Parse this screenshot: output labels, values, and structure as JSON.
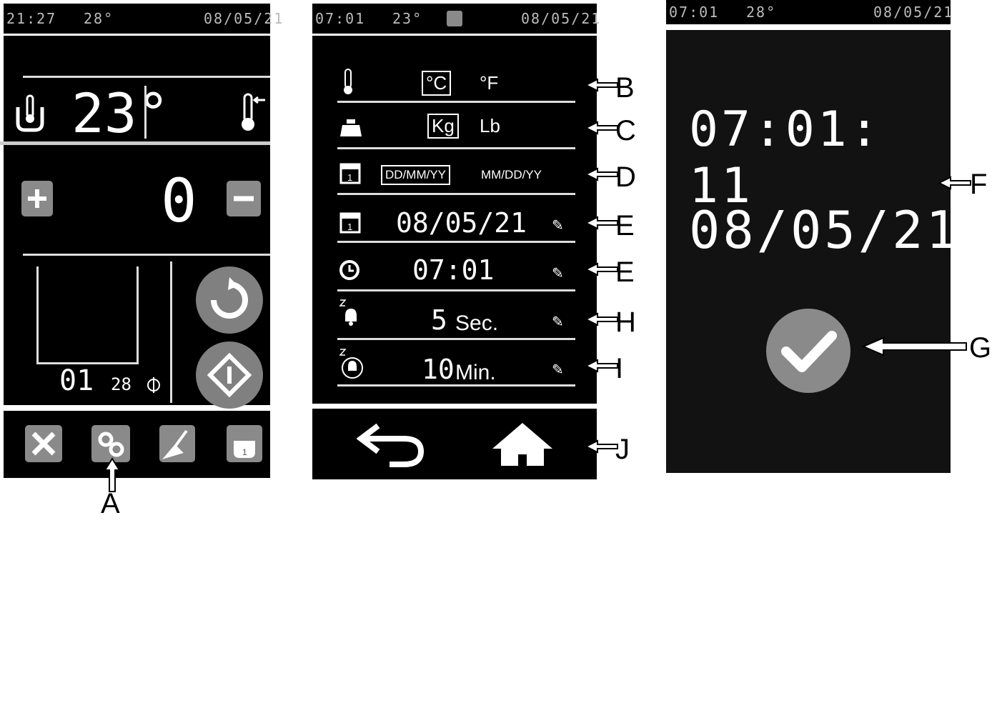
{
  "panel1": {
    "status": {
      "time": "21:27",
      "temp": "28°",
      "date": "08/05/21"
    },
    "temperature": "23°",
    "counter": "0",
    "program": "01",
    "small_value": "28"
  },
  "panel2": {
    "status": {
      "time": "07:01",
      "temp": "23°",
      "date": "08/05/21"
    },
    "temp_unit_options": [
      "°C",
      "°F"
    ],
    "weight_unit_options": [
      "Kg",
      "Lb"
    ],
    "date_format_options": [
      "DD/MM/YY",
      "MM/DD/YY"
    ],
    "date": "08/05/21",
    "time": "07:01",
    "alarm_duration": "5",
    "alarm_duration_unit": "Sec.",
    "repeat_interval": "10",
    "repeat_interval_unit": "Min."
  },
  "panel3": {
    "status": {
      "time": "07:01",
      "temp": "28°",
      "date": "08/05/21"
    },
    "clock_time": "07:01: 11",
    "clock_date": "08/05/21"
  },
  "callouts": {
    "A": "A",
    "B": "B",
    "C": "C",
    "D": "D",
    "E1": "E",
    "E2": "E",
    "F": "F",
    "G": "G",
    "H": "H",
    "I": "I",
    "J": "J"
  },
  "colors": {
    "screen_bg": "#000000",
    "button_gray": "#8a8a8a",
    "text": "#ffffff"
  },
  "icons": [
    "thermometer-icon",
    "container-temp-icon",
    "weight-icon",
    "calendar-icon",
    "clock-icon",
    "alarm-bell-icon",
    "repeat-alarm-icon",
    "pencil-icon",
    "back-icon",
    "home-icon",
    "tools-icon",
    "settings-gears-icon",
    "cleaning-icon",
    "recipe-icon",
    "check-icon",
    "reset-icon",
    "start-icon"
  ]
}
